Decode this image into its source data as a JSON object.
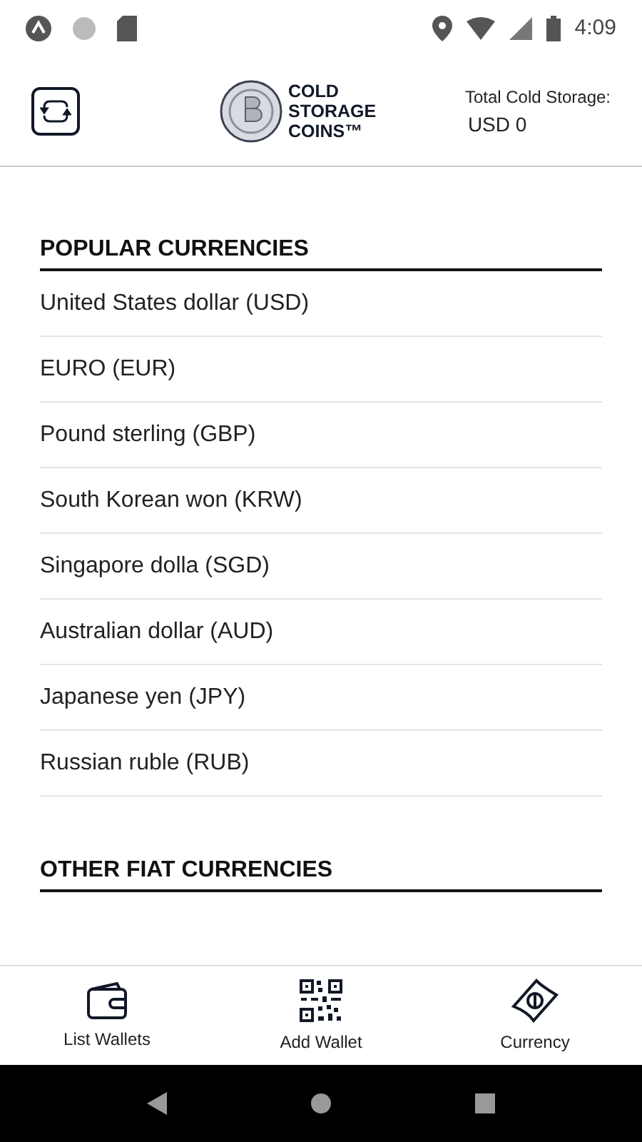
{
  "status_bar": {
    "time": "4:09"
  },
  "header": {
    "logo_lines": [
      "COLD",
      "STORAGE",
      "COINS™"
    ],
    "total_label": "Total Cold Storage:",
    "total_value": "USD 0"
  },
  "sections": [
    {
      "title": "POPULAR CURRENCIES",
      "items": [
        "United States dollar (USD)",
        "EURO (EUR)",
        "Pound sterling (GBP)",
        "South Korean won (KRW)",
        "Singapore dolla (SGD)",
        "Australian dollar (AUD)",
        "Japanese yen (JPY)",
        "Russian ruble (RUB)"
      ]
    },
    {
      "title": "OTHER FIAT CURRENCIES"
    }
  ],
  "bottom_nav": [
    {
      "kind": "wallet",
      "label": "List Wallets"
    },
    {
      "kind": "qr",
      "label": "Add Wallet"
    },
    {
      "kind": "money",
      "label": "Currency"
    }
  ]
}
